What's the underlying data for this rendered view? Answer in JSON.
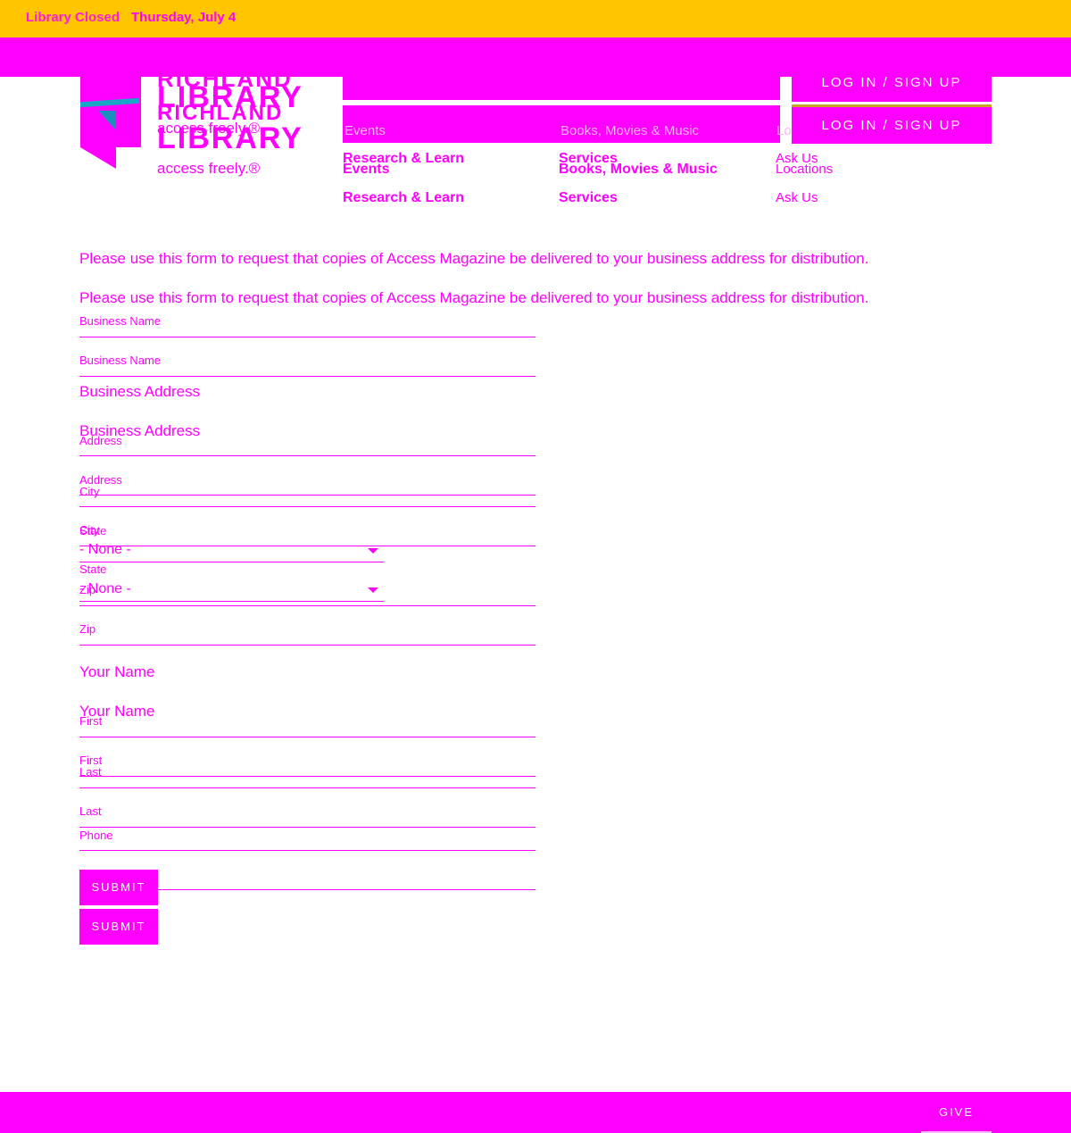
{
  "alert": {
    "text_main": "Thursday, July 4",
    "text_ghost": "Library Closed"
  },
  "logo": {
    "line1": "RICHLAND",
    "line2": "LIBRARY",
    "tagline": "access freely.®"
  },
  "header": {
    "login_label": "LOG IN / SIGN UP",
    "faded_search": "Books, Movies & Music",
    "faded_events": "Events",
    "faded_locations": "Locations"
  },
  "nav": {
    "events": "Events",
    "books": "Books, Movies & Music",
    "locations": "Locations",
    "research": "Research & Learn",
    "services": "Services",
    "ask": "Ask Us"
  },
  "form": {
    "intro": "Please use this form to request that copies of Access Magazine be delivered to your business address for distribution.",
    "business_name_label": "Business Name",
    "business_address_title": "Business Address",
    "address_label": "Address",
    "city_label": "City",
    "state_label": "State",
    "state_value": "- None -",
    "zip_label": "Zip",
    "your_name_title": "Your Name",
    "first_label": "First",
    "last_label": "Last",
    "phone_label": "Phone",
    "submit_label": "SUBMIT"
  },
  "footer": {
    "give_label": "GIVE"
  },
  "colors": {
    "alert_bg": "#ffc600",
    "accent": "#ff00ff",
    "logo_blue": "#1aa7c7"
  }
}
